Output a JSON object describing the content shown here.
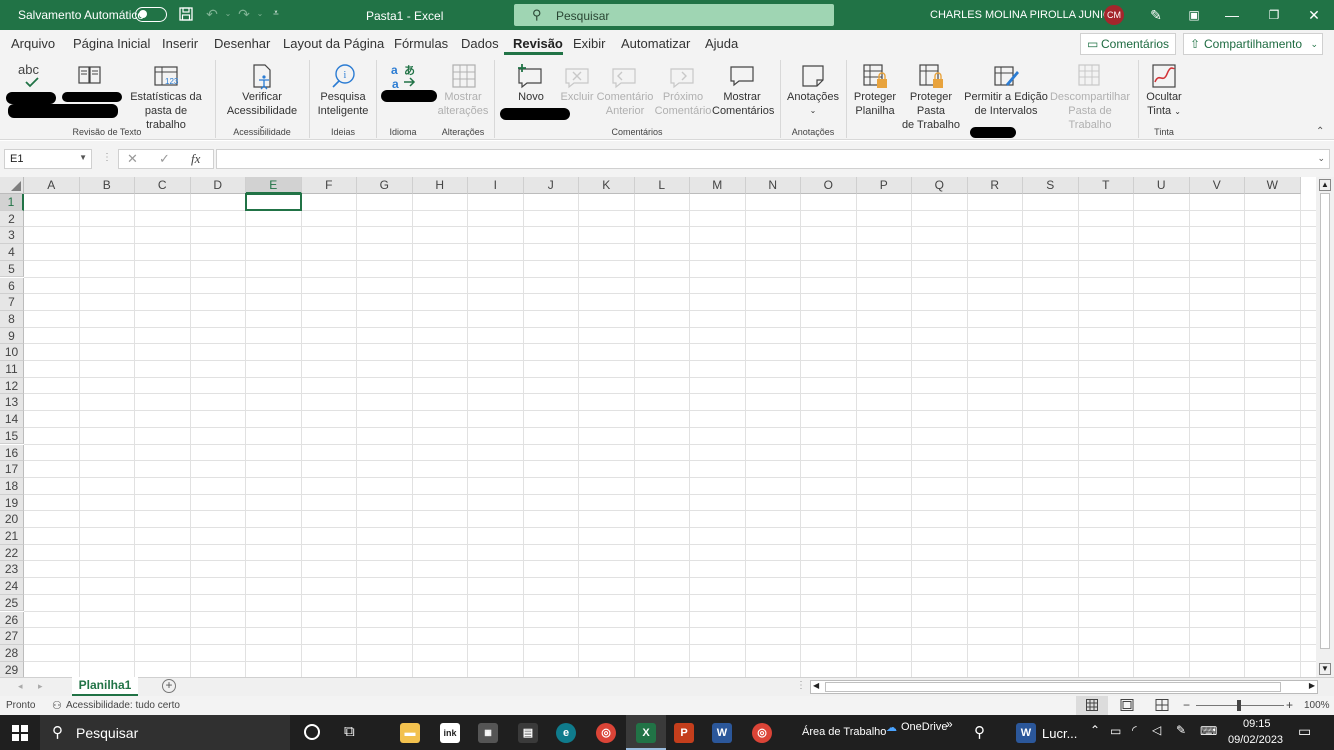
{
  "titlebar": {
    "autosave_label": "Salvamento Automático",
    "doc_title": "Pasta1  -  Excel",
    "search_label": "Pesquisar",
    "user_name": "CHARLES MOLINA PIROLLA JUNIOR",
    "avatar_initials": "CM"
  },
  "menu": {
    "items": [
      "Arquivo",
      "Página Inicial",
      "Inserir",
      "Desenhar",
      "Layout da Página",
      "Fórmulas",
      "Dados",
      "Revisão",
      "Exibir",
      "Automatizar",
      "Ajuda"
    ],
    "active": "Revisão",
    "comments_button": "Comentários",
    "share_button": "Compartilhamento"
  },
  "ribbon": {
    "spelling_icon_text": "abc",
    "stats_line1": "Estatísticas da",
    "stats_line2": "pasta de trabalho",
    "group_text_review": "Revisão de Texto",
    "check_access_line1": "Verificar",
    "check_access_line2": "Acessibilidade",
    "group_accessibility": "Acessibilidade",
    "smart_lookup_line1": "Pesquisa",
    "smart_lookup_line2": "Inteligente",
    "group_insights": "Ideias",
    "group_language": "Idioma",
    "show_changes_line1": "Mostrar",
    "show_changes_line2": "alterações",
    "group_changes": "Alterações",
    "new_comment": "Novo",
    "delete_comment": "Excluir",
    "prev_comment_line1": "Comentário",
    "prev_comment_line2": "Anterior",
    "next_comment_line1": "Próximo",
    "next_comment_line2": "Comentário",
    "show_comments_line1": "Mostrar",
    "show_comments_line2": "Comentários",
    "group_comments": "Comentários",
    "notes": "Anotações",
    "group_notes": "Anotações",
    "protect_sheet_line1": "Proteger",
    "protect_sheet_line2": "Planilha",
    "protect_workbook_line1": "Proteger Pasta",
    "protect_workbook_line2": "de Trabalho",
    "allow_edit_line1": "Permitir a Edição",
    "allow_edit_line2": "de Intervalos",
    "unshare_line1": "Descompartilhar",
    "unshare_line2": "Pasta de Trabalho",
    "hide_ink_line1": "Ocultar",
    "hide_ink_line2": "Tinta",
    "group_ink": "Tinta"
  },
  "formula_bar": {
    "name_box": "E1",
    "fx_label": "fx",
    "formula": ""
  },
  "grid": {
    "columns": [
      "A",
      "B",
      "C",
      "D",
      "E",
      "F",
      "G",
      "H",
      "I",
      "J",
      "K",
      "L",
      "M",
      "N",
      "O",
      "P",
      "Q",
      "R",
      "S",
      "T",
      "U",
      "V",
      "W"
    ],
    "rows": [
      "1",
      "2",
      "3",
      "4",
      "5",
      "6",
      "7",
      "8",
      "9",
      "10",
      "11",
      "12",
      "13",
      "14",
      "15",
      "16",
      "17",
      "18",
      "19",
      "20",
      "21",
      "22",
      "23",
      "24",
      "25",
      "26",
      "27",
      "28",
      "29"
    ],
    "selected_column": "E",
    "selected_row": "1"
  },
  "sheets": {
    "tabs": [
      "Planilha1"
    ],
    "active": "Planilha1"
  },
  "status": {
    "ready": "Pronto",
    "accessibility": "Acessibilidade: tudo certo",
    "zoom": "100%"
  },
  "taskbar": {
    "search_label": "Pesquisar",
    "desktop_label": "Área de Trabalho",
    "onedrive_label": "OneDrive",
    "lucro_label": "Lucr...",
    "time": "09:15",
    "date": "09/02/2023"
  },
  "colors": {
    "excel_green": "#217346",
    "taskbar_bg": "#1f1f1f"
  }
}
